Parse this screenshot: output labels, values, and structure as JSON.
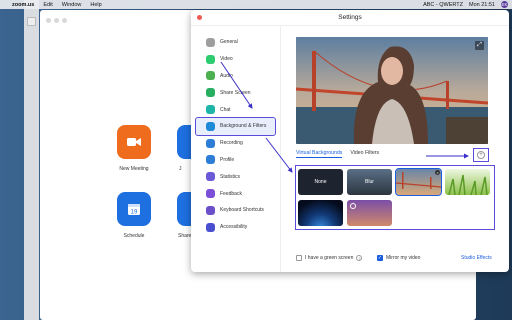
{
  "menubar": {
    "items": [
      "zoom.us",
      "Edit",
      "Window",
      "Help"
    ],
    "status": "ABC - QWERTZ",
    "time": "Mon 21:51",
    "avatar": "EK"
  },
  "home": {
    "new_meeting": "New Meeting",
    "schedule": "Schedule",
    "join_partial": "J",
    "share_partial": "Share"
  },
  "settings": {
    "title": "Settings",
    "nav": [
      {
        "label": "General",
        "color": "#9e9e9e",
        "icon": "gear-icon"
      },
      {
        "label": "Video",
        "color": "#2ecc71",
        "icon": "video-icon"
      },
      {
        "label": "Audio",
        "color": "#4cb050",
        "icon": "headphones-icon"
      },
      {
        "label": "Share Screen",
        "color": "#27ae60",
        "icon": "share-screen-icon"
      },
      {
        "label": "Chat",
        "color": "#1fb4a8",
        "icon": "chat-icon"
      },
      {
        "label": "Background & Filters",
        "color": "#1f8bd6",
        "icon": "background-icon"
      },
      {
        "label": "Recording",
        "color": "#2d7cd6",
        "icon": "recording-icon"
      },
      {
        "label": "Profile",
        "color": "#2d7cd6",
        "icon": "profile-icon"
      },
      {
        "label": "Statistics",
        "color": "#6b5ad8",
        "icon": "statistics-icon"
      },
      {
        "label": "Feedback",
        "color": "#7b4fd8",
        "icon": "feedback-icon"
      },
      {
        "label": "Keyboard Shortcuts",
        "color": "#6b4fc8",
        "icon": "keyboard-icon"
      },
      {
        "label": "Accessibility",
        "color": "#4a4fd0",
        "icon": "accessibility-icon"
      }
    ],
    "tabs": {
      "virtual": "Virtual Backgrounds",
      "filters": "Video Filters"
    },
    "backgrounds": {
      "none": "None",
      "blur": "Blur"
    },
    "green_screen": "I have a green screen",
    "mirror": "Mirror my video",
    "studio": "Studio Effects"
  }
}
